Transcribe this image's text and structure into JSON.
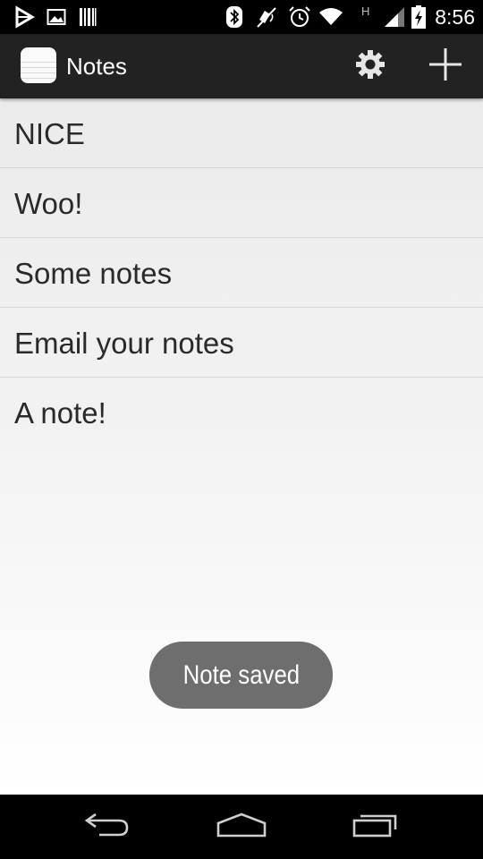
{
  "status_bar": {
    "time": "8:56",
    "network_type": "H",
    "icons": [
      "play-store-icon",
      "image-icon",
      "barcode-icon",
      "bluetooth-icon",
      "vibrate-icon",
      "alarm-icon",
      "wifi-icon",
      "signal-icon",
      "battery-charging-icon"
    ]
  },
  "action_bar": {
    "title": "Notes",
    "app_icon": "notes-app-icon",
    "actions": [
      "settings-icon",
      "add-icon"
    ]
  },
  "notes": [
    {
      "title": "NICE"
    },
    {
      "title": "Woo!"
    },
    {
      "title": "Some notes"
    },
    {
      "title": "Email your notes"
    },
    {
      "title": "A note!"
    }
  ],
  "toast": {
    "message": "Note saved"
  },
  "nav_bar": {
    "buttons": [
      "back-icon",
      "home-icon",
      "recent-apps-icon"
    ]
  },
  "colors": {
    "status_bar_bg": "#000000",
    "action_bar_bg": "#222222",
    "list_text": "#2a2a2a",
    "divider": "#d6d6d6",
    "toast_bg": "#6e6e6e",
    "nav_bar_bg": "#000000"
  }
}
